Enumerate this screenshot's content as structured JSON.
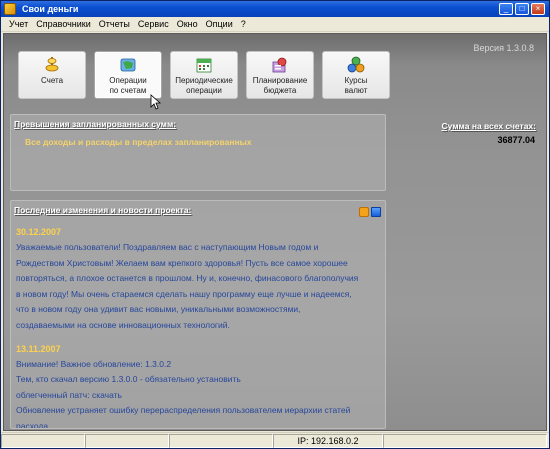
{
  "window": {
    "title": "Свои деньги"
  },
  "menu": [
    "Учет",
    "Справочники",
    "Отчеты",
    "Сервис",
    "Окно",
    "Опции",
    "?"
  ],
  "version": "Версия 1.3.0.8",
  "toolbar": [
    {
      "label": "Счета",
      "icon": "coins-icon"
    },
    {
      "label": "Операции\nпо счетам",
      "icon": "globe-icon"
    },
    {
      "label": "Периодические\nоперации",
      "icon": "calendar-icon"
    },
    {
      "label": "Планирование\nбюджета",
      "icon": "planning-icon"
    },
    {
      "label": "Курсы\nвалют",
      "icon": "currency-icon"
    }
  ],
  "exceed": {
    "title": "Превышения запланированных сумм:",
    "message": "Все доходы и расходы в пределах запланированных"
  },
  "total": {
    "label": "Сумма на всех счетах:",
    "value": "36877.04"
  },
  "news": {
    "title": "Последние изменения и новости проекта:",
    "items": [
      {
        "date": "30.12.2007",
        "lines": [
          "Уважаемые пользователи! Поздравляем вас с наступающим Новым годом и",
          "Рождеством Христовым! Желаем вам крепкого здоровья! Пусть все самое хорошее",
          "повторяться, а плохое останется в прошлом. Ну и, конечно, финасового благополучия",
          " в новом году! Мы очень стараемся сделать нашу программу еще лучше и надеемся,",
          "что в новом году она удивит вас новыми, уникальными возможностями,",
          "создаваемыми на основе инновационных технологий."
        ]
      },
      {
        "date": "13.11.2007",
        "lines": [
          "Внимание! Важное обновление: 1.3.0.2",
          "Тем, кто скачал версию 1.3.0.0 - обязательно установить",
          "облегченный патч: скачать",
          "Обновление устраняет ошибку перераспределения пользователем иерархии статей",
          "расхода"
        ]
      }
    ]
  },
  "status": {
    "ip": "IP: 192.168.0.2"
  },
  "colors": {
    "titlebar": "#0a4fd0",
    "exceed_text": "#f5d36b",
    "news_text": "#27479c",
    "news_date": "#ffd24a"
  }
}
